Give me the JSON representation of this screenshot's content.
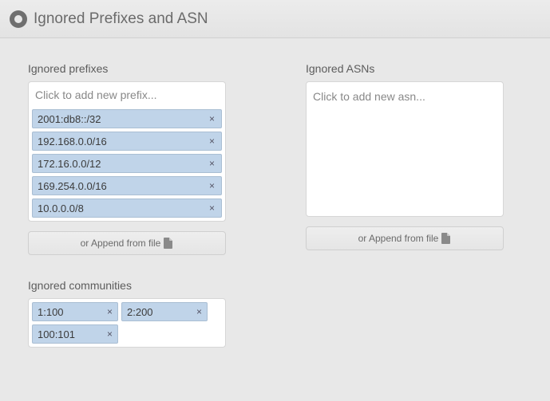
{
  "header": {
    "title": "Ignored Prefixes and ASN"
  },
  "sections": {
    "prefixes": {
      "label": "Ignored prefixes",
      "placeholder": "Click to add new prefix...",
      "tags": [
        "2001:db8::/32",
        "192.168.0.0/16",
        "172.16.0.0/12",
        "169.254.0.0/16",
        "10.0.0.0/8"
      ],
      "append_btn": "or Append from file"
    },
    "asns": {
      "label": "Ignored ASNs",
      "placeholder": "Click to add new asn...",
      "append_btn": "or Append from file"
    },
    "communities": {
      "label": "Ignored communities",
      "tags": [
        "1:100",
        "2:200",
        "100:101"
      ]
    }
  },
  "icons": {
    "remove": "×"
  }
}
